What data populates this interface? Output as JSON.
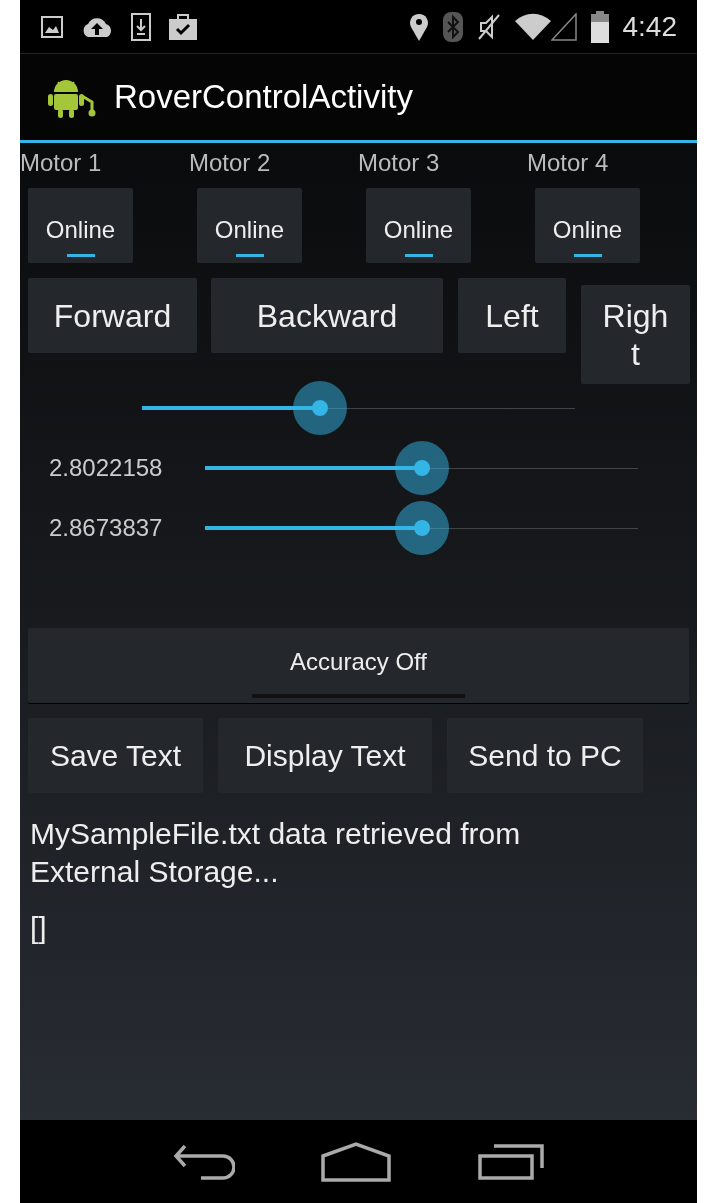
{
  "status_bar": {
    "time": "4:42"
  },
  "action_bar": {
    "title": "RoverControlActivity"
  },
  "motors": [
    {
      "label": "Motor 1",
      "toggle": "Online",
      "on": true
    },
    {
      "label": "Motor 2",
      "toggle": "Online",
      "on": true
    },
    {
      "label": "Motor 3",
      "toggle": "Online",
      "on": true
    },
    {
      "label": "Motor 4",
      "toggle": "Online",
      "on": true
    }
  ],
  "direction_buttons": [
    "Forward",
    "Backward",
    "Left",
    "Right"
  ],
  "sliders": [
    {
      "level": 0.41
    },
    {
      "reading": "2.8022158",
      "level": 0.5
    },
    {
      "reading": "2.8673837",
      "level": 0.5
    }
  ],
  "accuracy_toggle": {
    "label": "Accuracy Off",
    "on": false
  },
  "action_buttons": [
    "Save Text",
    "Display Text",
    "Send to PC"
  ],
  "output_text": "MySampleFile.txt data retrieved from External Storage...",
  "output_value": "[]"
}
